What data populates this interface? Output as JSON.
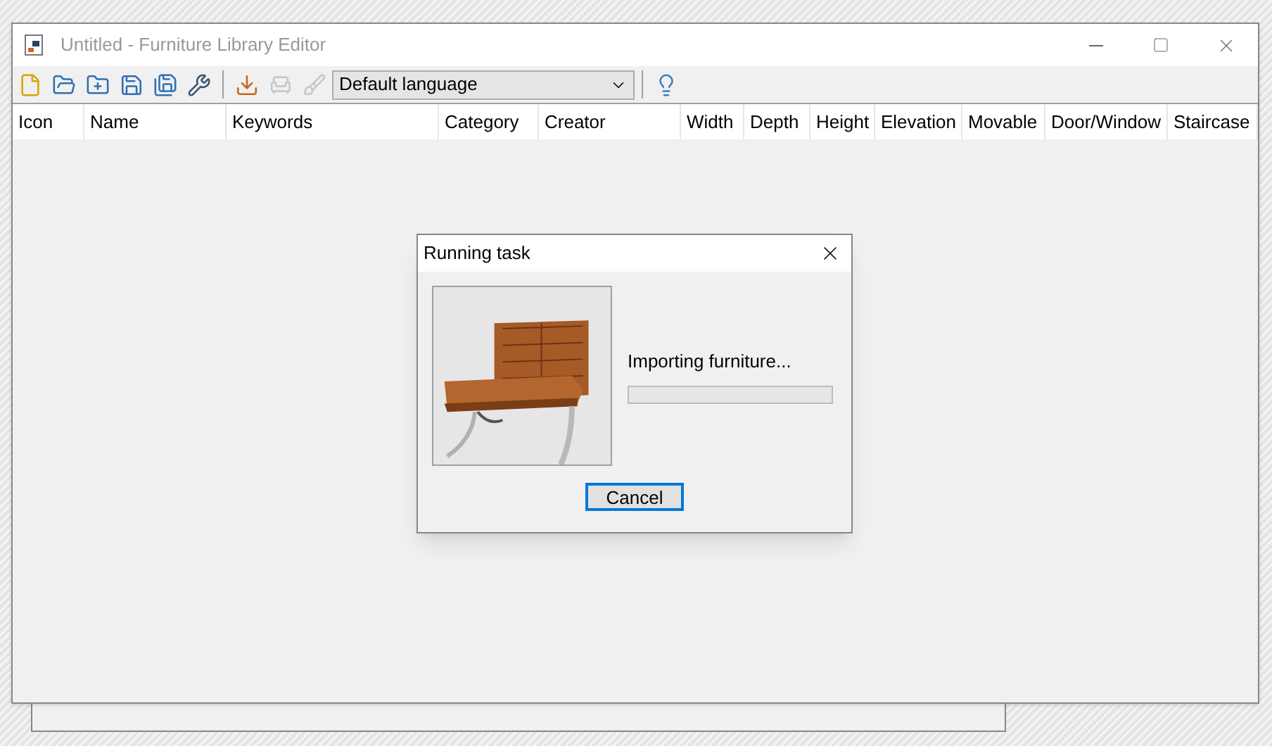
{
  "window": {
    "title": "Untitled - Furniture Library Editor"
  },
  "toolbar": {
    "items": [
      {
        "kind": "new",
        "disabled": false
      },
      {
        "kind": "open",
        "disabled": false
      },
      {
        "kind": "merge",
        "disabled": false
      },
      {
        "kind": "save",
        "disabled": false
      },
      {
        "kind": "saveas",
        "disabled": false
      },
      {
        "kind": "preferences",
        "disabled": false
      },
      {
        "kind": "separator"
      },
      {
        "kind": "import",
        "disabled": false
      },
      {
        "kind": "modify",
        "disabled": true
      },
      {
        "kind": "delete",
        "disabled": true
      },
      {
        "kind": "language",
        "value": "Default language"
      },
      {
        "kind": "separator"
      },
      {
        "kind": "help",
        "disabled": false
      }
    ]
  },
  "table": {
    "columns": [
      "Icon",
      "Name",
      "Keywords",
      "Category",
      "Creator",
      "Width",
      "Depth",
      "Height",
      "Elevation",
      "Movable",
      "Door/Window",
      "Staircase"
    ]
  },
  "dialog": {
    "title": "Running task",
    "message": "Importing furniture...",
    "buttons": [
      "Cancel"
    ]
  }
}
